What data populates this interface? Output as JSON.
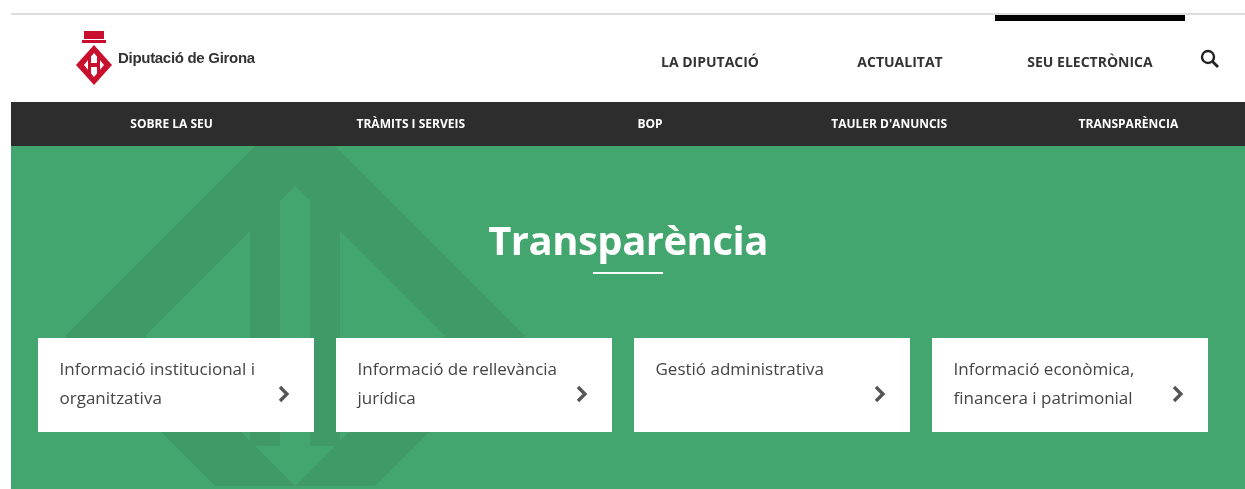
{
  "logo": {
    "text": "Diputació de Girona"
  },
  "main_nav": [
    {
      "label": "LA DIPUTACIÓ",
      "selected": false
    },
    {
      "label": "ACTUALITAT",
      "selected": false
    },
    {
      "label": "SEU ELECTRÒNICA",
      "selected": true
    }
  ],
  "sub_nav": [
    "SOBRE LA SEU",
    "TRÀMITS I SERVEIS",
    "BOP",
    "TAULER D'ANUNCIS",
    "TRANSPARÈNCIA"
  ],
  "hero": {
    "title": "Transparència"
  },
  "cards": [
    {
      "label": "Informació institucional i organitzativa"
    },
    {
      "label": "Informació de rellevància jurídica"
    },
    {
      "label": "Gestió administrativa"
    },
    {
      "label": "Informació econòmica, financera i patrimonial"
    }
  ]
}
